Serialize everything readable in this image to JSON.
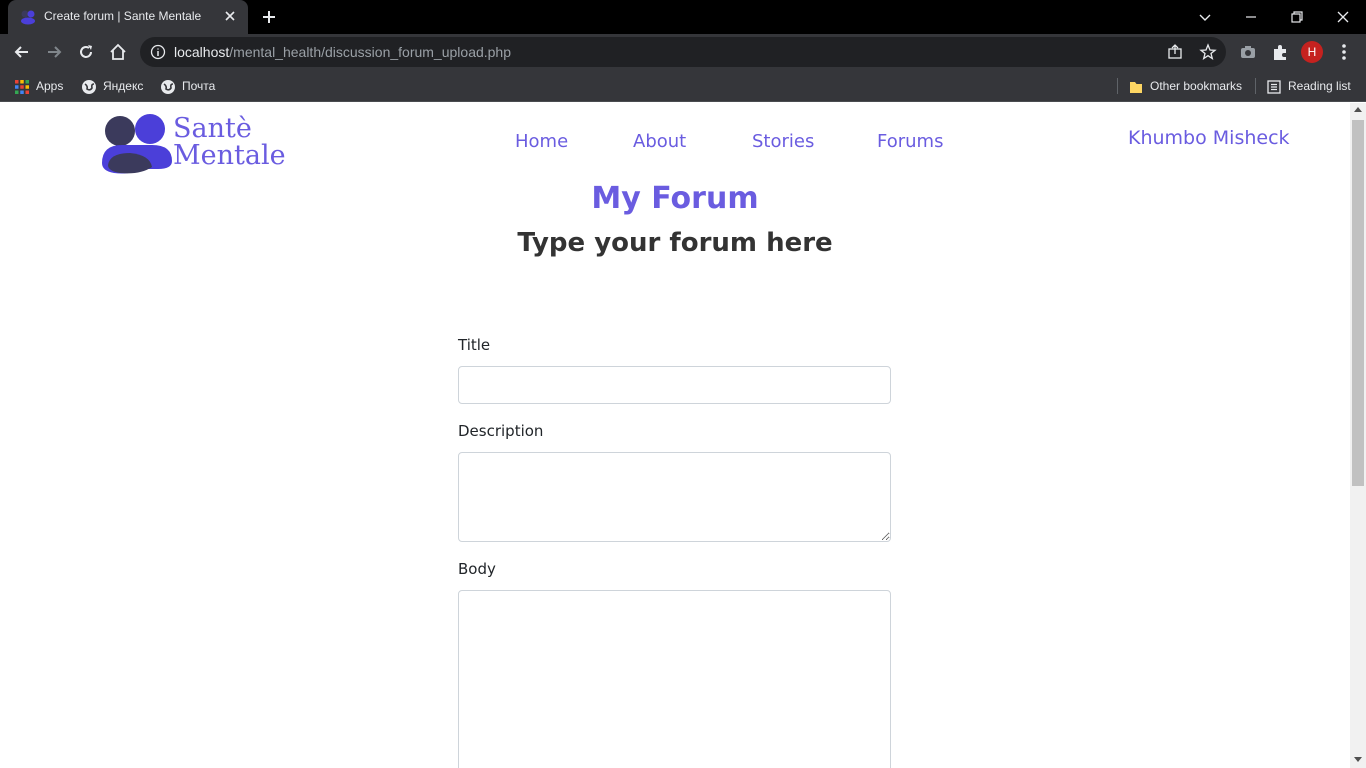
{
  "browser": {
    "tab_title": "Create forum | Sante Mentale",
    "url_host": "localhost",
    "url_path": "/mental_health/discussion_forum_upload.php",
    "profile_initial": "H",
    "bookmarks": {
      "apps": "Apps",
      "yandex": "Яндекс",
      "pochta": "Почта",
      "other": "Other bookmarks",
      "reading": "Reading list"
    }
  },
  "site": {
    "logo_line1": "Santè",
    "logo_line2": "Mentale",
    "nav": {
      "home": "Home",
      "about": "About",
      "stories": "Stories",
      "forums": "Forums"
    },
    "user_name": "Khumbo Misheck"
  },
  "main": {
    "heading": "My Forum",
    "subheading": "Type your forum here",
    "form": {
      "title_label": "Title",
      "title_value": "",
      "description_label": "Description",
      "description_value": "",
      "body_label": "Body",
      "body_value": ""
    }
  },
  "colors": {
    "accent": "#6a5ce0",
    "logo_dark": "#3b3a5c",
    "logo_blue": "#4b3fd9"
  }
}
